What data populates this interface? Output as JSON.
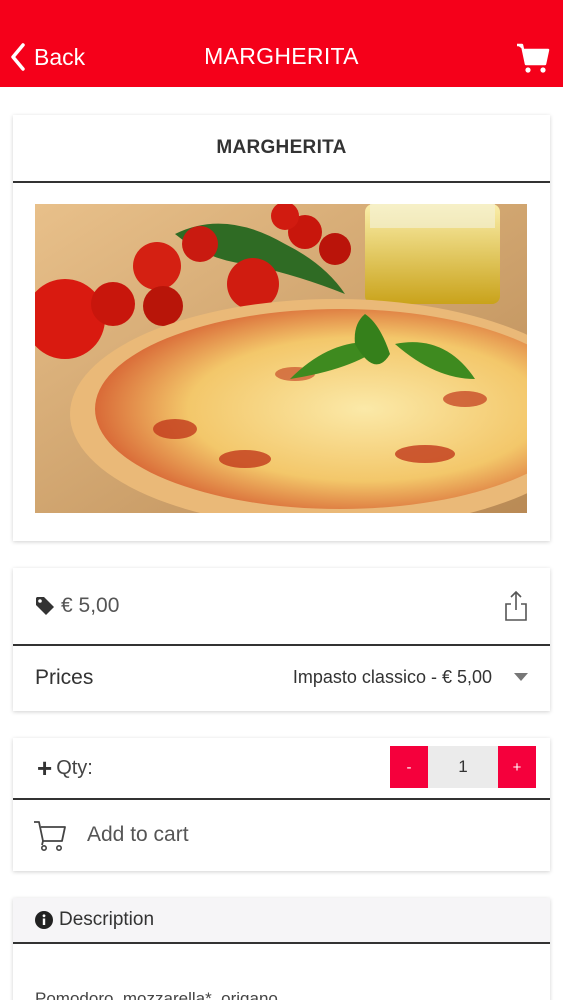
{
  "navbar": {
    "back_label": "Back",
    "title": "MARGHERITA",
    "back_icon": "chevron-left-icon",
    "cart_icon": "cart-icon"
  },
  "product": {
    "title": "MARGHERITA",
    "image_alt": "pizza-photo"
  },
  "pricing": {
    "price": "€ 5,00",
    "prices_label": "Prices",
    "selected_option": "Impasto classico - € 5,00"
  },
  "quantity": {
    "label": "Qty:",
    "minus": "-",
    "value": "1",
    "plus": "+"
  },
  "cart": {
    "add_label": "Add to cart"
  },
  "description": {
    "heading": "Description",
    "text": "Pomodoro, mozzarella*, origano"
  },
  "colors": {
    "brand_red": "#f5001a",
    "stepper_red": "#f5003c"
  }
}
